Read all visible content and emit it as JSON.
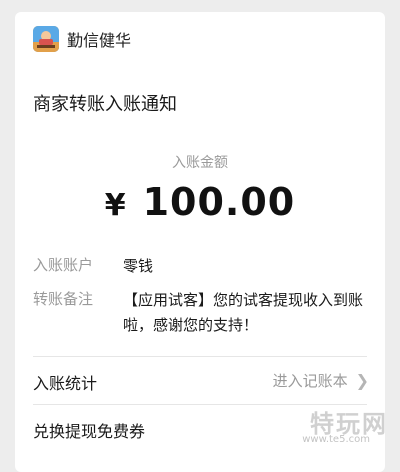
{
  "app": {
    "name": "勤信健华",
    "icon": "app-logo-icon"
  },
  "notice": {
    "title": "商家转账入账通知"
  },
  "amount": {
    "label": "入账金额",
    "currency": "¥",
    "value": "100.00"
  },
  "details": [
    {
      "key": "入账账户",
      "value": "零钱"
    },
    {
      "key": "转账备注",
      "value": "【应用试客】您的试客提现收入到账啦，感谢您的支持！"
    }
  ],
  "stats": {
    "label": "入账统计",
    "link": "进入记账本"
  },
  "coupon": {
    "label": "兑换提现免费券"
  },
  "watermark": {
    "text": "特玩网",
    "sub": "www.te5.com"
  },
  "colors": {
    "background": "#ededed",
    "card": "#ffffff",
    "muted": "#9a9a9a",
    "text": "#1a1a1a"
  }
}
